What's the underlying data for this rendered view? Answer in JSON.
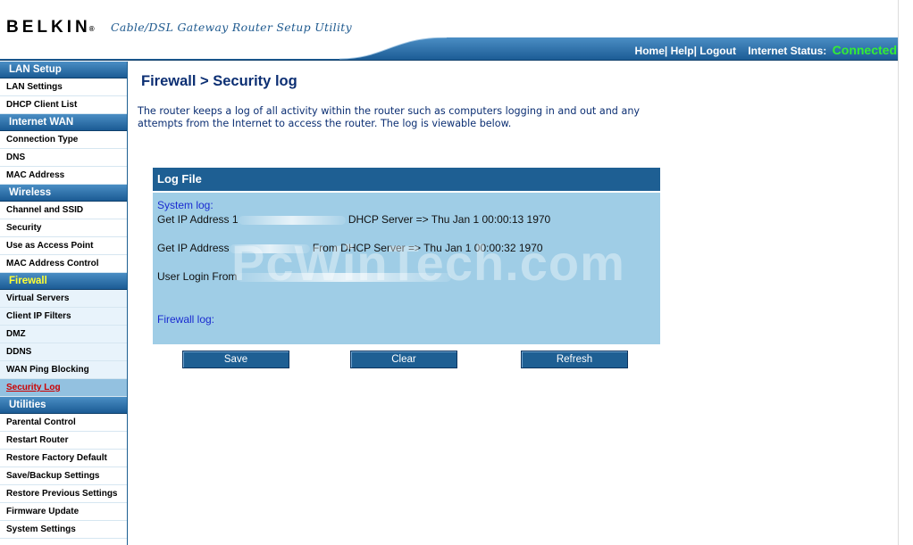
{
  "header": {
    "brand": "BELKIN",
    "brand_mark": "®",
    "tagline": "Cable/DSL Gateway Router Setup Utility",
    "nav": {
      "home": "Home",
      "help": "Help",
      "logout": "Logout",
      "sep": "|"
    },
    "status_label": "Internet Status:",
    "status_value": "Connected",
    "status_color": "#33ee33"
  },
  "sidebar": {
    "sections": [
      {
        "title": "LAN Setup",
        "items": [
          "LAN Settings",
          "DHCP Client List"
        ]
      },
      {
        "title": "Internet WAN",
        "items": [
          "Connection Type",
          "DNS",
          "MAC Address"
        ]
      },
      {
        "title": "Wireless",
        "items": [
          "Channel and SSID",
          "Security",
          "Use as Access Point",
          "MAC Address Control"
        ]
      },
      {
        "title": "Firewall",
        "items": [
          "Virtual Servers",
          "Client IP Filters",
          "DMZ",
          "DDNS",
          "WAN Ping Blocking",
          "Security Log"
        ]
      },
      {
        "title": "Utilities",
        "items": [
          "Parental Control",
          "Restart Router",
          "Restore Factory Default",
          "Save/Backup Settings",
          "Restore Previous Settings",
          "Firmware Update",
          "System Settings"
        ]
      }
    ]
  },
  "main": {
    "title": "Firewall > Security log",
    "description": "The router keeps a log of all activity within the router such as computers logging in and out and any attempts from the Internet to access the router. The log is viewable below.",
    "log": {
      "header": "Log File",
      "system_label": "System log:",
      "line1_a": "Get IP Address 1",
      "line1_b": "DHCP Server => Thu Jan 1 00:00:13 1970",
      "line2_a": "Get IP Address",
      "line2_b": "From DHCP Server => Thu Jan 1 00:00:32 1970",
      "line3_a": "User Login From",
      "firewall_label": "Firewall log:"
    },
    "watermark": "PcWinTech.com",
    "buttons": {
      "save": "Save",
      "clear": "Clear",
      "refresh": "Refresh"
    }
  },
  "colors": {
    "nav_blue": "#1e5f93",
    "log_bg": "#9fcde6",
    "title_blue": "#0c2f73",
    "active_link": "#cc0000"
  }
}
